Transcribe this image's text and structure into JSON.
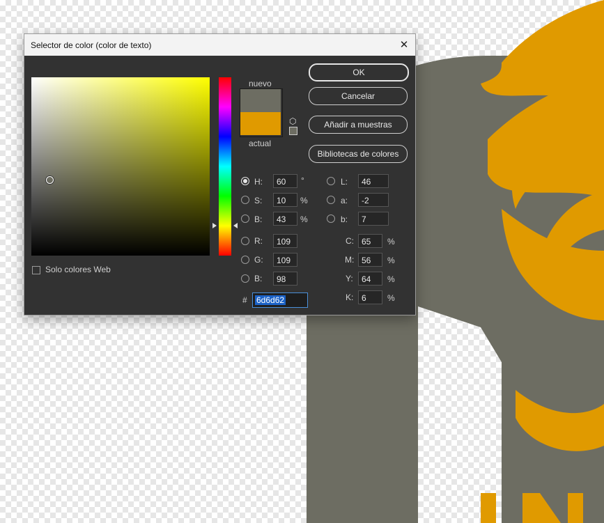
{
  "dialog": {
    "title": "Selector de color (color de texto)",
    "close_glyph": "✕"
  },
  "swatches": {
    "new_label": "nuevo",
    "current_label": "actual",
    "new_color": "#6d6d62",
    "current_color": "#e09a00",
    "cube_icon": "cube-icon"
  },
  "buttons": {
    "ok": "OK",
    "cancel": "Cancelar",
    "add_swatches": "Añadir a muestras",
    "color_libraries": "Bibliotecas de colores"
  },
  "hsb": {
    "h_label": "H:",
    "h_value": "60",
    "h_unit": "°",
    "s_label": "S:",
    "s_value": "10",
    "s_unit": "%",
    "b_label": "B:",
    "b_value": "43",
    "b_unit": "%",
    "selected": "H"
  },
  "lab": {
    "l_label": "L:",
    "l_value": "46",
    "a_label": "a:",
    "a_value": "-2",
    "b_label": "b:",
    "b_value": "7"
  },
  "rgb": {
    "r_label": "R:",
    "r_value": "109",
    "g_label": "G:",
    "g_value": "109",
    "b_label": "B:",
    "b_value": "98"
  },
  "cmyk": {
    "c_label": "C:",
    "c_value": "65",
    "c_unit": "%",
    "m_label": "M:",
    "m_value": "56",
    "m_unit": "%",
    "y_label": "Y:",
    "y_value": "64",
    "y_unit": "%",
    "k_label": "K:",
    "k_value": "6",
    "k_unit": "%"
  },
  "hex": {
    "label": "#",
    "value": "6d6d62"
  },
  "web_only": {
    "label": "Solo colores Web",
    "checked": false
  },
  "canvas": {
    "gray": "#6d6d62",
    "orange": "#e09a00"
  }
}
